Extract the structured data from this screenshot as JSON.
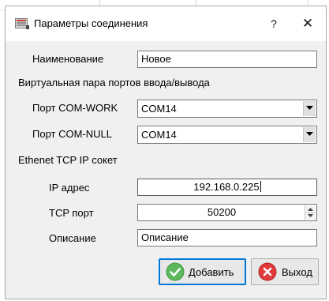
{
  "window": {
    "title": "Параметры соединения",
    "help_glyph": "?",
    "close_glyph": "✕",
    "icon": "connection-settings-icon"
  },
  "form": {
    "name_label": "Наименование",
    "name_value": "Новое",
    "virtual_pair_heading": "Виртуальная пара портов ввода/вывода",
    "com_work_label": "Порт COM-WORK",
    "com_work_value": "COM14",
    "com_null_label": "Порт COM-NULL",
    "com_null_value": "COM14",
    "ethernet_heading": "Ethenet TCP IP сокет",
    "ip_label": "IP адрес",
    "ip_value": "192.168.0.225",
    "tcp_port_label": "TCP порт",
    "tcp_port_value": "50200",
    "description_label": "Описание",
    "description_value": "Описание"
  },
  "buttons": {
    "add_label": "Добавить",
    "add_icon": "check-icon",
    "exit_label": "Выход",
    "exit_icon": "close-circle-icon"
  },
  "colors": {
    "dialog_bg": "#f0f0f0",
    "titlebar_bg": "#ffffff",
    "focus_border": "#0078d7",
    "add_icon_green": "#5cb85c",
    "exit_icon_red": "#e03a3a"
  }
}
